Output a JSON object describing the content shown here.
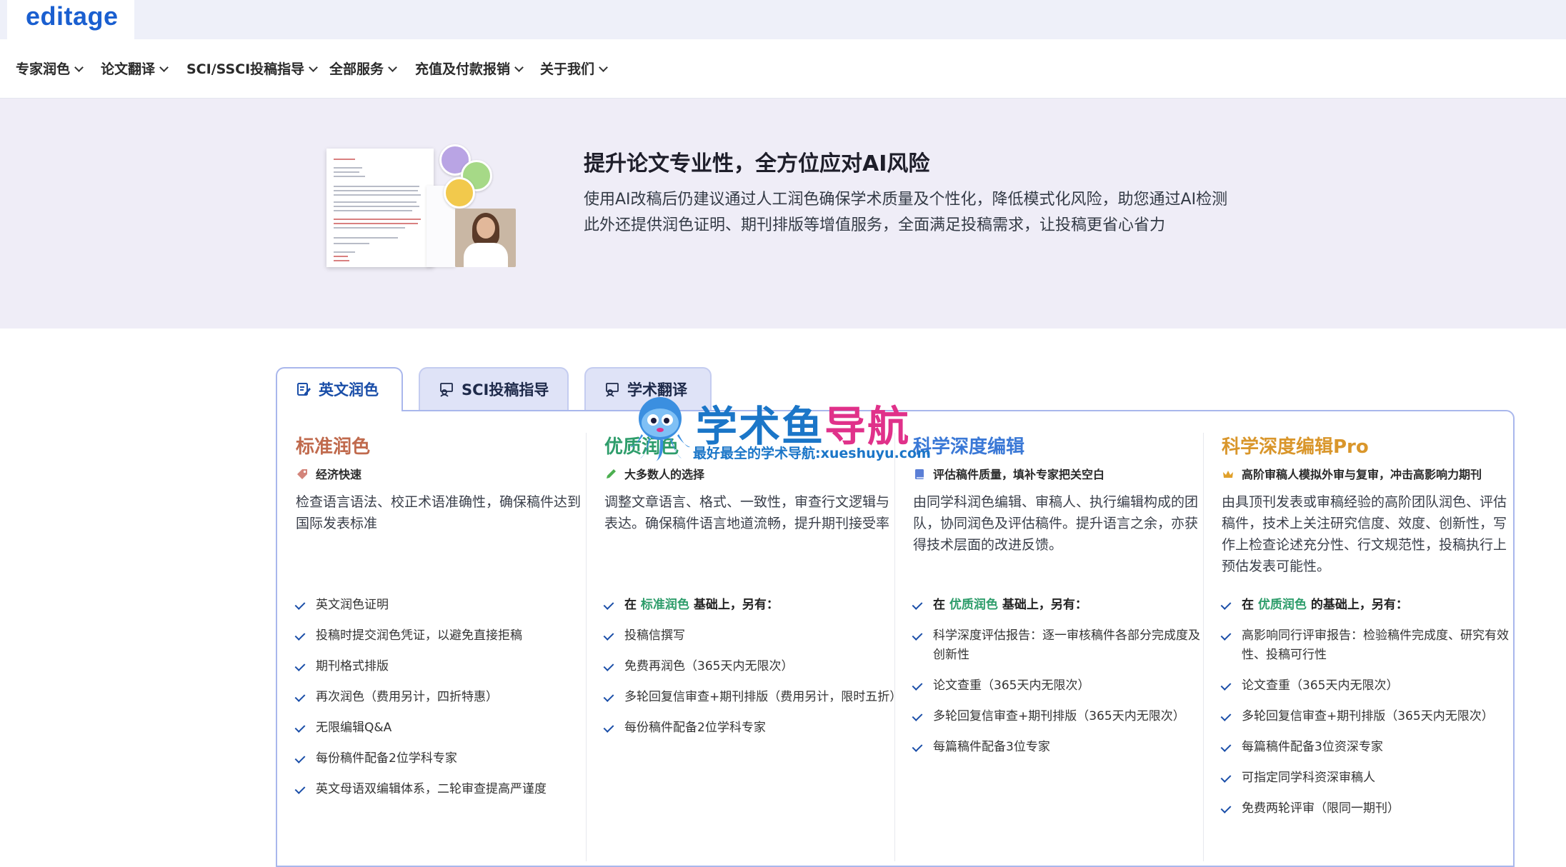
{
  "header": {
    "logo": "editage"
  },
  "nav": {
    "items": [
      {
        "label": "专家润色"
      },
      {
        "label": "论文翻译"
      },
      {
        "label": "SCI/SSCI投稿指导"
      },
      {
        "label": "全部服务"
      },
      {
        "label": "充值及付款报销"
      },
      {
        "label": "关于我们"
      }
    ]
  },
  "hero": {
    "title": "提升论文专业性，全方位应对AI风险",
    "desc_line1": "使用AI改稿后仍建议通过人工润色确保学术质量及个性化，降低模式化风险，助您通过AI检测",
    "desc_line2": "此外还提供润色证明、期刊排版等增值服务，全面满足投稿需求，让投稿更省心省力"
  },
  "tabs": [
    {
      "label": "英文润色",
      "active": true
    },
    {
      "label": "SCI投稿指导",
      "active": false
    },
    {
      "label": "学术翻译",
      "active": false
    }
  ],
  "plans": [
    {
      "title": "标准润色",
      "title_color": "#c06a4d",
      "tagline": "经济快速",
      "desc": "检查语言语法、校正术语准确性，确保稿件达到国际发表标准",
      "features": [
        "英文润色证明",
        "投稿时提交润色凭证，以避免直接拒稿",
        "期刊格式排版",
        "再次润色（费用另计，四折特惠）",
        "无限编辑Q&A",
        "每份稿件配备2位学科专家",
        "英文母语双编辑体系，二轮审查提高严谨度"
      ]
    },
    {
      "title": "优质润色",
      "title_color": "#2e9d6b",
      "tagline": "大多数人的选择",
      "desc": "调整文章语言、格式、一致性，审查行文逻辑与表达。确保稿件语言地道流畅，提升期刊接受率",
      "base_prefix": "在",
      "base_ref": "标准润色",
      "base_suffix": "基础上，另有：",
      "features": [
        "投稿信撰写",
        "免费再润色（365天内无限次）",
        "多轮回复信审查+期刊排版（费用另计，限时五折）",
        "每份稿件配备2位学科专家"
      ]
    },
    {
      "title": "科学深度编辑",
      "title_color": "#3a78d6",
      "tagline": "评估稿件质量，填补专家把关空白",
      "desc": "由同学科润色编辑、审稿人、执行编辑构成的团队，协同润色及评估稿件。提升语言之余，亦获得技术层面的改进反馈。",
      "base_prefix": "在",
      "base_ref": "优质润色",
      "base_suffix": "基础上，另有：",
      "features": [
        "科学深度评估报告：逐一审核稿件各部分完成度及创新性",
        "论文查重（365天内无限次）",
        "多轮回复信审查+期刊排版（365天内无限次）",
        "每篇稿件配备3位专家"
      ]
    },
    {
      "title": "科学深度编辑Pro",
      "title_color": "#d9962b",
      "tagline": "高阶审稿人模拟外审与复审，冲击高影响力期刊",
      "desc": "由具顶刊发表或审稿经验的高阶团队润色、评估稿件，技术上关注研究信度、效度、创新性，写作上检查论述充分性、行文规范性，投稿执行上预估发表可能性。",
      "base_prefix": "在",
      "base_ref": "优质润色",
      "base_suffix": "的基础上，另有：",
      "features": [
        "高影响同行评审报告：检验稿件完成度、研究有效性、投稿可行性",
        "论文查重（365天内无限次）",
        "多轮回复信审查+期刊排版（365天内无限次）",
        "每篇稿件配备3位资深专家",
        "可指定同学科资深审稿人",
        "免费两轮评审（限同一期刊）"
      ]
    }
  ],
  "watermark": {
    "title_a": "学术鱼",
    "title_b": "导航",
    "subtitle": "最好最全的学术导航:xueshuyu.com"
  }
}
